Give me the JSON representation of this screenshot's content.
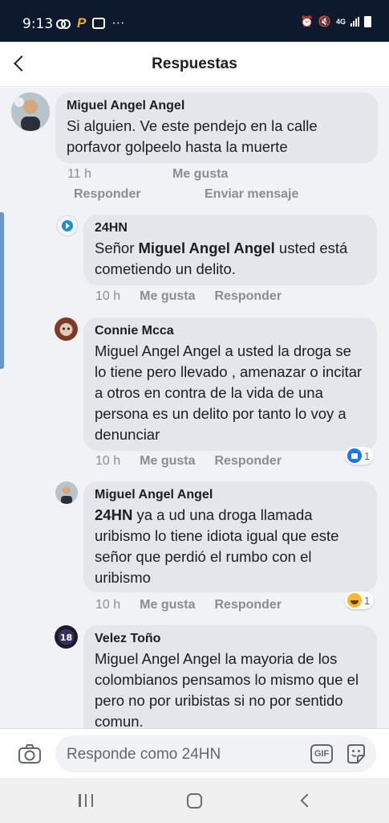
{
  "status_bar": {
    "time": "9:13",
    "network": "4G"
  },
  "header": {
    "title": "Respuestas"
  },
  "top_comment": {
    "author": "Miguel Angel Angel",
    "text": "Si alguien. Ve este pendejo en la calle porfavor golpeelo hasta la muerte",
    "time": "11 h",
    "like": "Me gusta",
    "reply": "Responder",
    "message": "Enviar mensaje"
  },
  "replies": [
    {
      "author": "24HN",
      "text_prefix": "Señor ",
      "mention": "Miguel Angel Angel",
      "text_suffix": " usted está cometiendo un delito.",
      "time": "10 h",
      "like": "Me gusta",
      "reply": "Responder"
    },
    {
      "author": "Connie Mcca",
      "text": "Miguel Angel Angel  a usted la droga se lo tiene pero llevado , amenazar o incitar a otros en contra de la vida de una persona es un delito por tanto lo voy a denunciar",
      "time": "10 h",
      "like": "Me gusta",
      "reply": "Responder",
      "reaction": {
        "icon": "like",
        "count": "1"
      }
    },
    {
      "author": "Miguel Angel Angel",
      "mention": "24HN",
      "text_suffix": " ya a ud una droga llamada uribismo lo tiene idiota igual que este señor que perdió el rumbo con el uribismo",
      "time": "10 h",
      "like": "Me gusta",
      "reply": "Responder",
      "reaction": {
        "icon": "haha",
        "count": "1"
      }
    },
    {
      "author": "Velez Toño",
      "text": "Miguel Angel Angel la mayoria de los colombianos pensamos lo mismo que el pero no por uribistas si no por sentido comun."
    }
  ],
  "composer": {
    "placeholder": "Responde como 24HN",
    "gif_label": "GIF"
  },
  "colors": {
    "bubble": "#e4e6eb",
    "background": "#f0f2f5",
    "status_bar": "#0d1a2e",
    "like_blue": "#1877f2"
  }
}
